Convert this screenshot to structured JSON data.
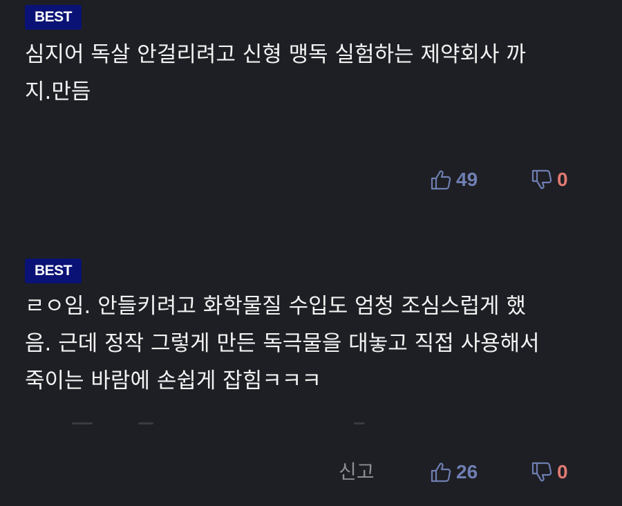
{
  "comments": [
    {
      "badge": "BEST",
      "text_lines": [
        "심지어 독살 안걸리려고 신형 맹독 실험하는 제약회사 까",
        "지.만듬"
      ],
      "report_label": "",
      "likes": "49",
      "dislikes": "0"
    },
    {
      "badge": "BEST",
      "text_lines": [
        "ㄹㅇ임. 안들키려고 화학물질 수입도 엄청 조심스럽게 했",
        "음. 근데 정작 그렇게 만든 독극물을 대놓고 직접 사용해서",
        "죽이는 바람에 손쉽게 잡힘ㅋㅋㅋ"
      ],
      "report_label": "신고",
      "likes": "26",
      "dislikes": "0"
    }
  ],
  "colors": {
    "background": "#1e1f24",
    "badge_bg": "#0a1275",
    "like_color": "#6f7fb3",
    "dislike_color": "#e07a73",
    "report_color": "#8e8e93"
  },
  "icons": {
    "like": "thumbs-up-icon",
    "dislike": "thumbs-down-icon"
  }
}
